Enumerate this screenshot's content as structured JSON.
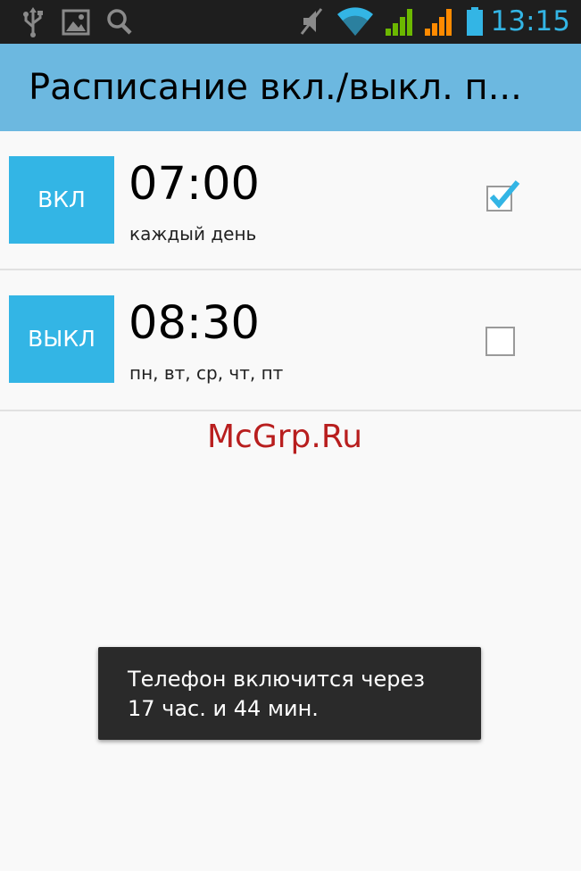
{
  "status_bar": {
    "time": "13:15",
    "left_icons": [
      "usb-icon",
      "image-icon",
      "search-icon"
    ],
    "right_icons": [
      "mute-icon",
      "wifi-icon",
      "signal-green-icon",
      "signal-orange-icon",
      "battery-icon"
    ]
  },
  "action_bar": {
    "title": "Расписание вкл./выкл. п..."
  },
  "schedule": [
    {
      "badge": "ВКЛ",
      "time": "07:00",
      "days": "каждый день",
      "enabled": true
    },
    {
      "badge": "ВЫКЛ",
      "time": "08:30",
      "days": "пн, вт, ср, чт, пт",
      "enabled": false
    }
  ],
  "watermark": "McGrp.Ru",
  "toast": {
    "line1": "Телефон включится через",
    "line2": "17 час. и  44 мин."
  },
  "colors": {
    "action_bar": "#6cb8e0",
    "accent": "#33b5e5",
    "status_bar": "#1e1e1e",
    "toast": "#2a2a2a",
    "watermark": "#b81e1e"
  }
}
